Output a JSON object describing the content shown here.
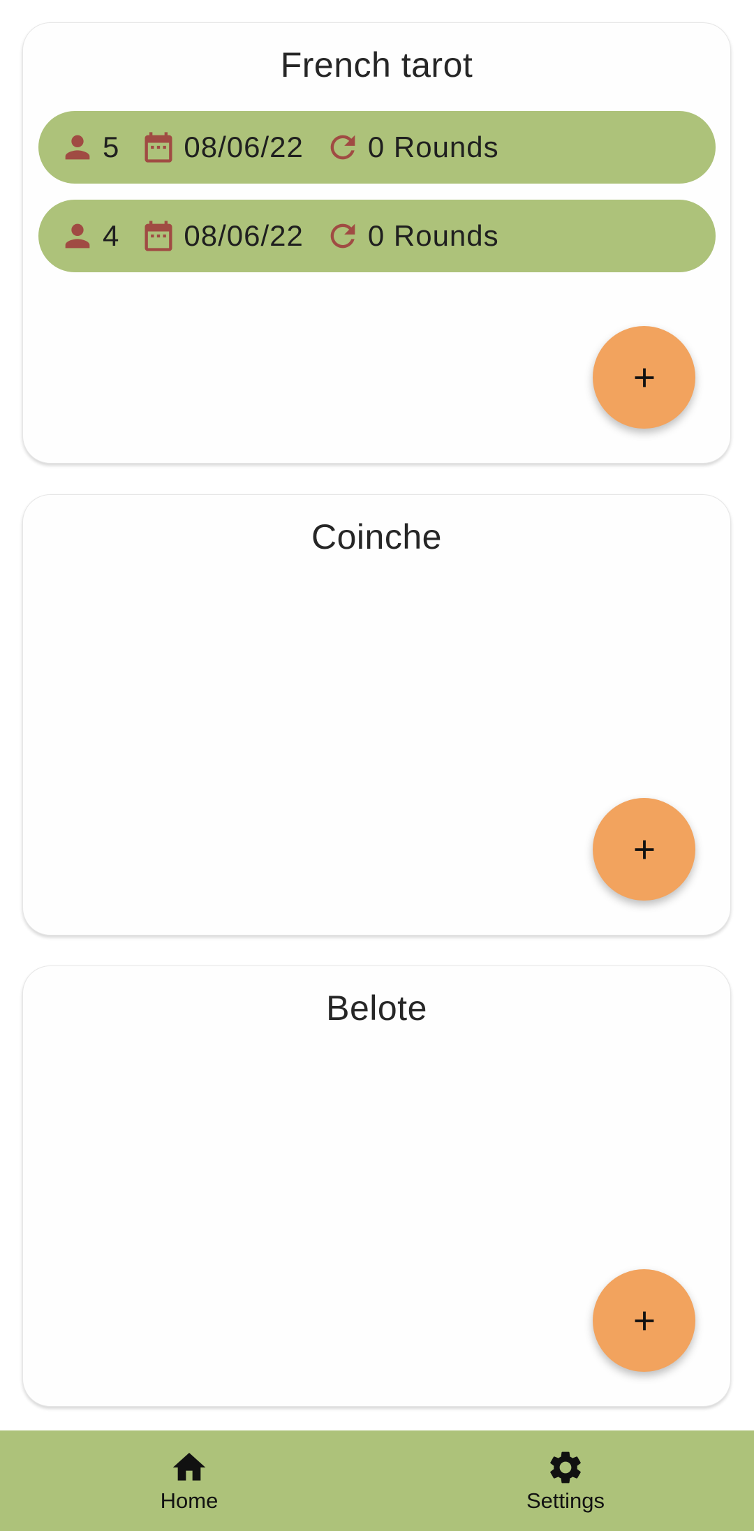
{
  "colors": {
    "row_background": "#adc27a",
    "icon_accent": "#a04b43",
    "fab_background": "#f2a35e",
    "nav_background": "#adc27a"
  },
  "sections": [
    {
      "title": "French tarot",
      "games": [
        {
          "players": "5",
          "date": "08/06/22",
          "rounds": "0 Rounds"
        },
        {
          "players": "4",
          "date": "08/06/22",
          "rounds": "0 Rounds"
        }
      ],
      "add_icon": "plus-icon"
    },
    {
      "title": "Coinche",
      "games": [],
      "add_icon": "plus-icon"
    },
    {
      "title": "Belote",
      "games": [],
      "add_icon": "plus-icon"
    }
  ],
  "row_icons": [
    "person-icon",
    "calendar-icon",
    "refresh-icon"
  ],
  "bottom_nav": {
    "items": [
      {
        "label": "Home",
        "icon": "home-icon"
      },
      {
        "label": "Settings",
        "icon": "gear-icon"
      }
    ]
  }
}
